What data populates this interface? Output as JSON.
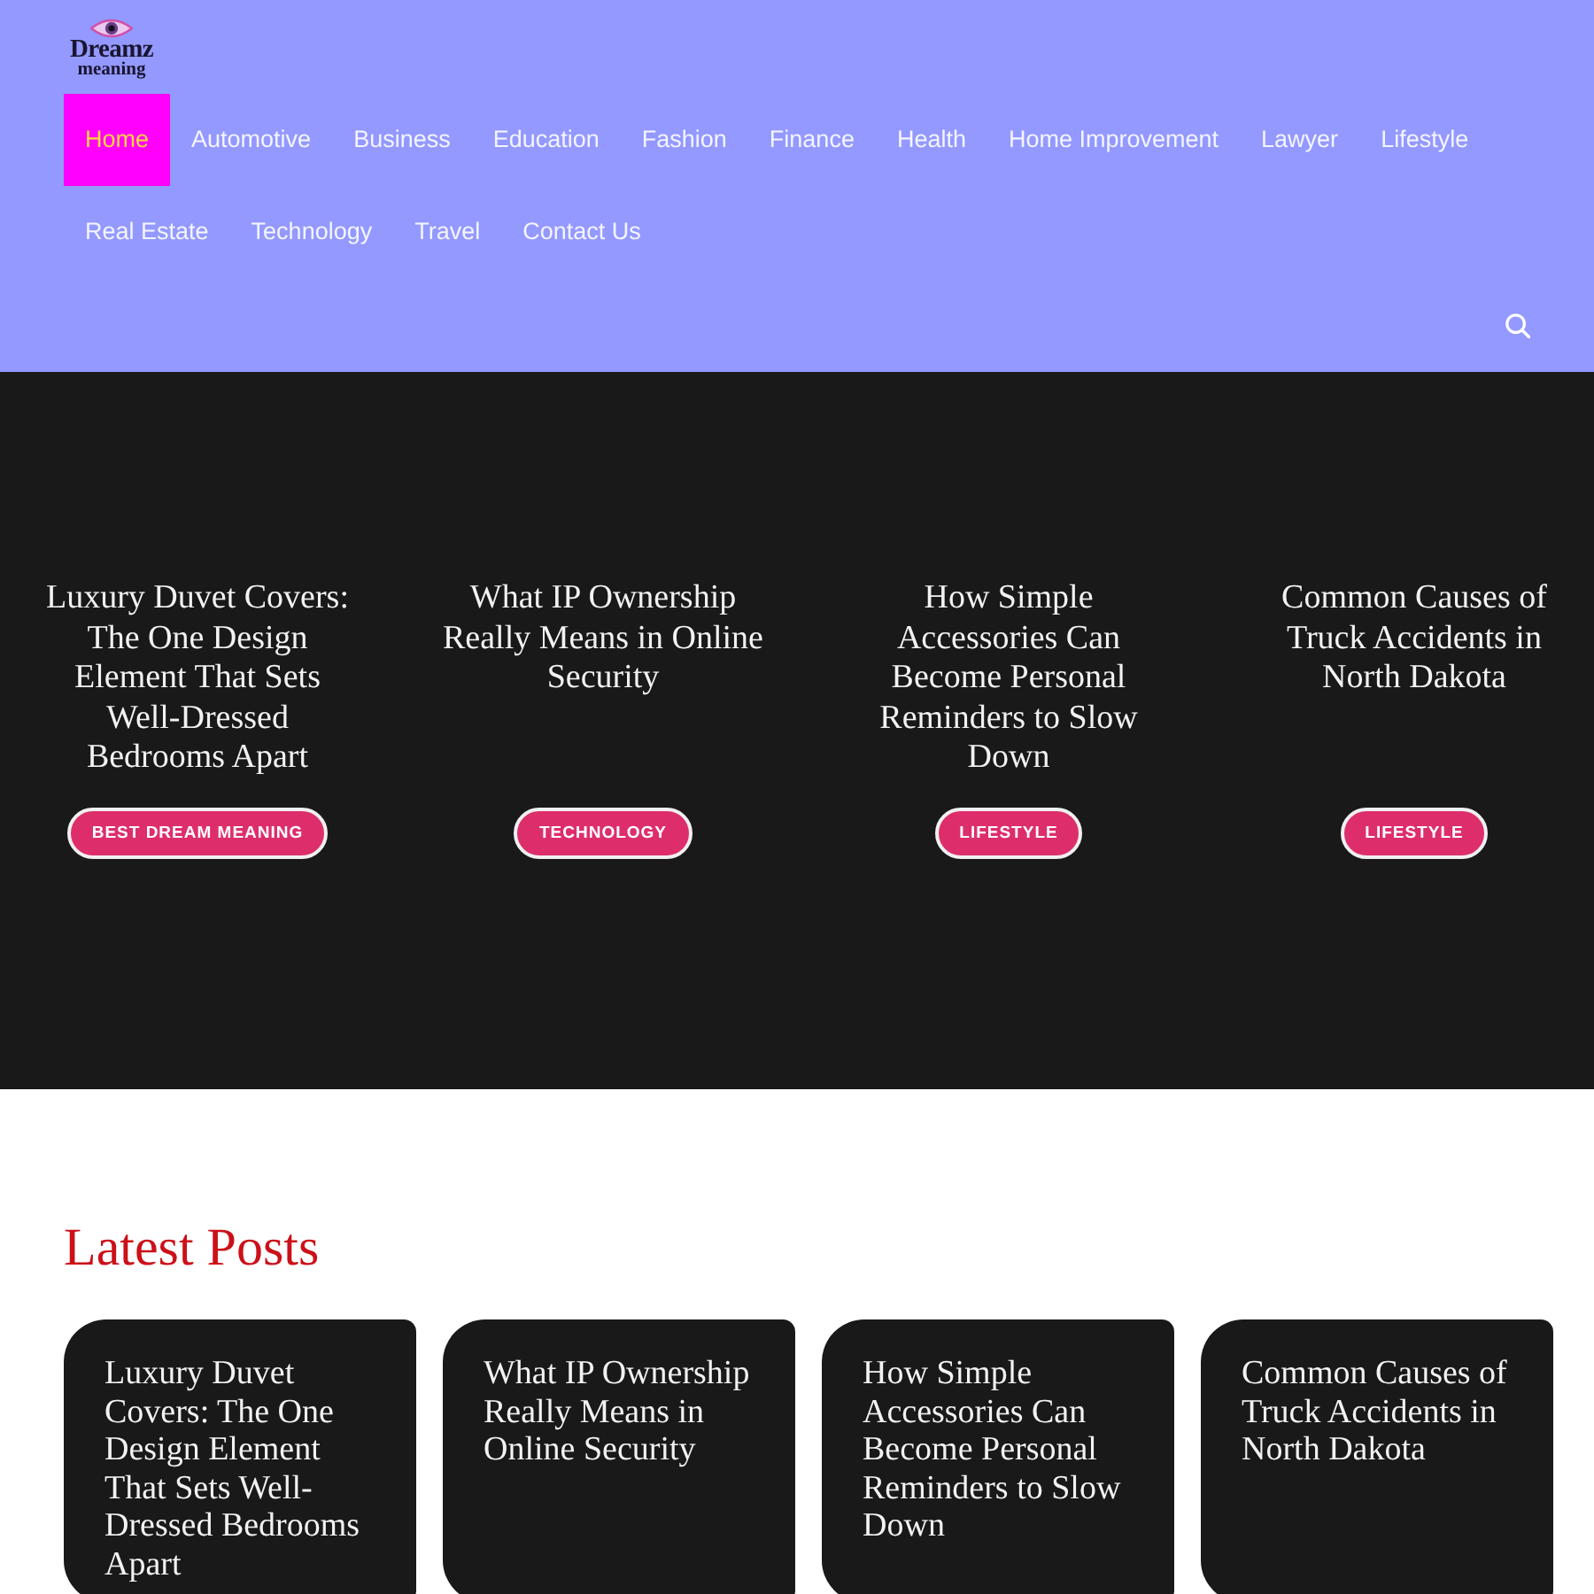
{
  "header": {
    "logo": {
      "line_1": "Dreamz",
      "line_2": "meaning"
    },
    "nav": [
      {
        "label": "Home",
        "selected": true
      },
      {
        "label": "Automotive",
        "selected": false
      },
      {
        "label": "Business",
        "selected": false
      },
      {
        "label": "Education",
        "selected": false
      },
      {
        "label": "Fashion",
        "selected": false
      },
      {
        "label": "Finance",
        "selected": false
      },
      {
        "label": "Health",
        "selected": false
      },
      {
        "label": "Home Improvement",
        "selected": false
      },
      {
        "label": "Lawyer",
        "selected": false
      },
      {
        "label": "Lifestyle",
        "selected": false
      },
      {
        "label": "Real Estate",
        "selected": false
      },
      {
        "label": "Technology",
        "selected": false
      },
      {
        "label": "Travel",
        "selected": false
      },
      {
        "label": "Contact Us",
        "selected": false
      }
    ]
  },
  "hero": {
    "posts": [
      {
        "title": "Luxury Duvet Covers: The One Design Element That Sets Well-Dressed Bedrooms Apart",
        "category": "BEST DREAM MEANING"
      },
      {
        "title": "What IP Ownership Really Means in Online Security",
        "category": "TECHNOLOGY"
      },
      {
        "title": "How Simple Accessories Can Become Personal Reminders to Slow Down",
        "category": "LIFESTYLE"
      },
      {
        "title": "Common Causes of Truck Accidents in North Dakota",
        "category": "LIFESTYLE"
      }
    ]
  },
  "latest_posts": {
    "heading": "Latest Posts",
    "posts": [
      {
        "title": "Luxury Duvet Covers: The One Design Element That Sets Well-Dressed Bedrooms Apart"
      },
      {
        "title": "What IP Ownership Really Means in Online Security"
      },
      {
        "title": "How Simple Accessories Can Become Personal Reminders to Slow Down"
      },
      {
        "title": "Common Causes of Truck Accidents in North Dakota"
      }
    ]
  }
}
